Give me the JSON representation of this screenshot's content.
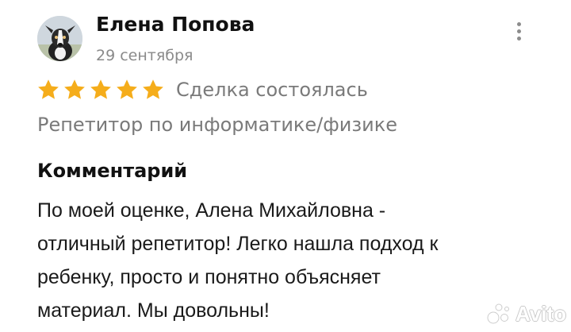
{
  "review": {
    "author_name": "Елена Попова",
    "date": "29 сентября",
    "rating": 5,
    "rating_max": 5,
    "deal_status": "Сделка состоялась",
    "category": "Репетитор по информатике/физике",
    "comment_heading": "Комментарий",
    "comment_lines": [
      "По моей оценке, Алена Михайловна -",
      "отличный репетитор! Легко нашла подход к",
      "ребенку, просто и понятно объясняет",
      "материал. Мы довольны!"
    ]
  },
  "icons": {
    "avatar": "dog-photo",
    "menu": "more-vertical-icon",
    "star": "star-icon"
  },
  "watermark": {
    "text": "Avito"
  },
  "colors": {
    "star": "#f5ad1b",
    "muted_text": "#7a7a7a",
    "date_text": "#8a8a8a",
    "primary_text": "#111111"
  }
}
